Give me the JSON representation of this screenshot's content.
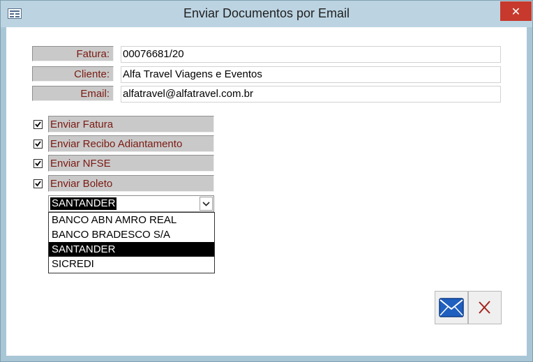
{
  "window": {
    "title": "Enviar Documentos por Email",
    "close_glyph": "✕"
  },
  "fields": [
    {
      "label": "Fatura:",
      "value": "00076681/20"
    },
    {
      "label": "Cliente:",
      "value": "Alfa Travel Viagens e Eventos"
    },
    {
      "label": "Email:",
      "value": "alfatravel@alfatravel.com.br"
    }
  ],
  "options": [
    {
      "label": "Enviar Fatura",
      "checked": true
    },
    {
      "label": "Enviar Recibo Adiantamento",
      "checked": true
    },
    {
      "label": "Enviar NFSE",
      "checked": true
    },
    {
      "label": "Enviar Boleto",
      "checked": true
    }
  ],
  "bank_select": {
    "value": "SANTANDER",
    "options": [
      "BANCO ABN AMRO REAL",
      "BANCO BRADESCO S/A",
      "SANTANDER",
      "SICREDI"
    ],
    "selected_index": 2
  },
  "buttons": {
    "send_icon": "envelope-icon",
    "cancel_icon": "x-icon"
  },
  "colors": {
    "label_text": "#7a1a12",
    "label_bg": "#c9c9c9",
    "titlebar": "#bcd4e2",
    "close": "#c7392c"
  }
}
